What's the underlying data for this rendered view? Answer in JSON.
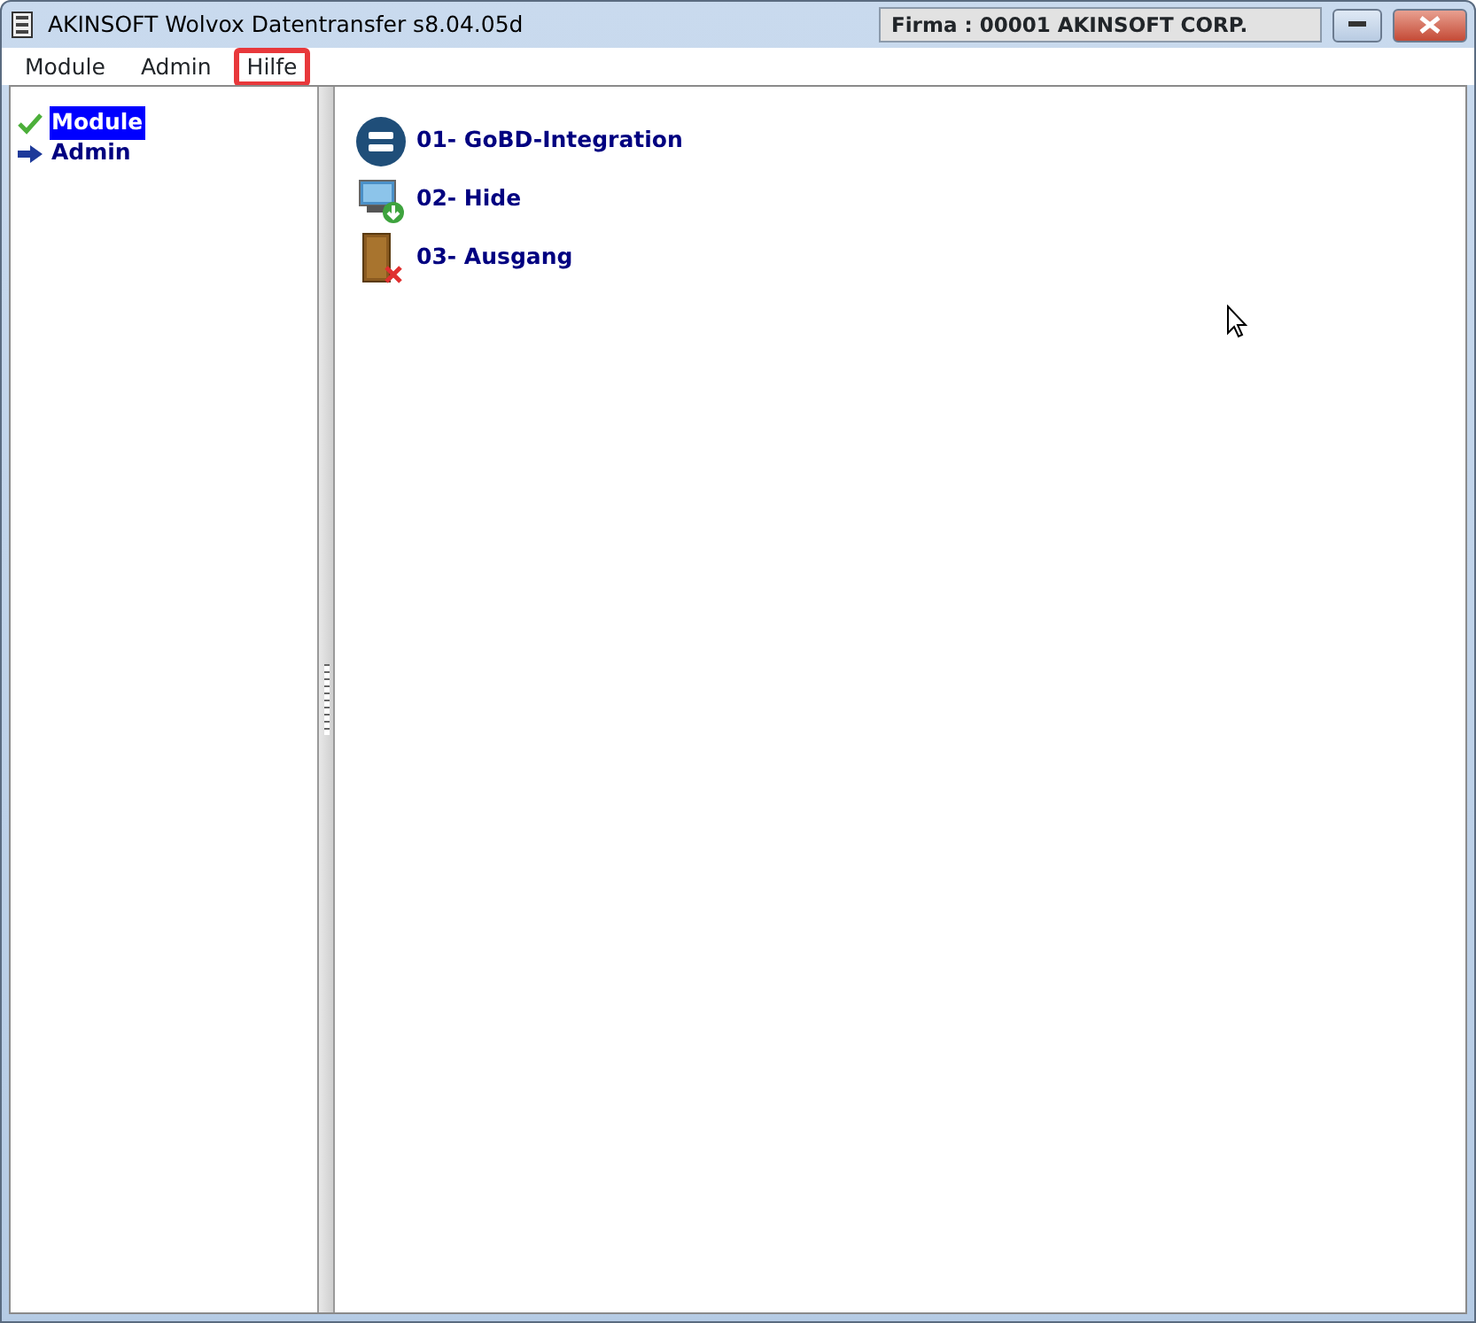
{
  "window": {
    "title": "AKINSOFT Wolvox Datentransfer s8.04.05d",
    "company": "Firma : 00001 AKINSOFT CORP."
  },
  "menu": [
    {
      "label": "Module",
      "highlighted": false
    },
    {
      "label": "Admin",
      "highlighted": false
    },
    {
      "label": "Hilfe",
      "highlighted": true
    }
  ],
  "sidebar": {
    "items": [
      {
        "label": "Module",
        "selected": true,
        "kind": "check"
      },
      {
        "label": "Admin",
        "selected": false,
        "kind": "arrow"
      }
    ]
  },
  "modules": [
    {
      "label": "01- GoBD-Integration",
      "kind": "equals"
    },
    {
      "label": "02- Hide",
      "kind": "monitor"
    },
    {
      "label": "03- Ausgang",
      "kind": "door"
    }
  ]
}
